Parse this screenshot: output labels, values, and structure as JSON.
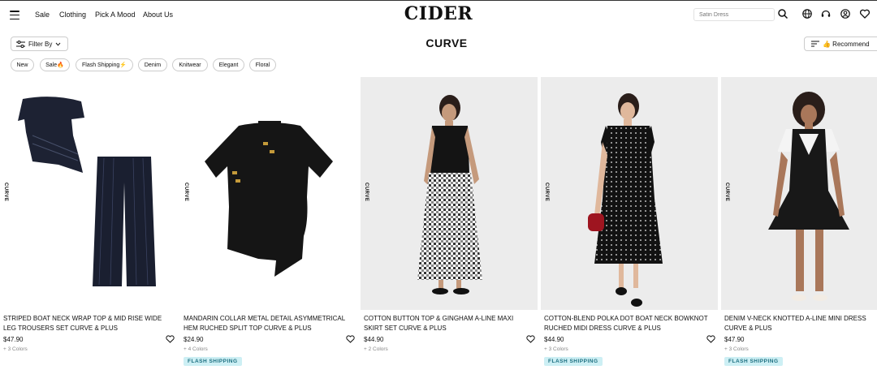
{
  "header": {
    "logo": "CIDER",
    "nav": [
      "Sale",
      "Clothing",
      "Pick A Mood",
      "About Us"
    ],
    "search_placeholder": "Satin Dress",
    "icons": [
      "menu-icon",
      "search-icon",
      "globe-icon",
      "support-icon",
      "account-icon",
      "wishlist-icon"
    ]
  },
  "toolbar": {
    "filter_label": "Filter By",
    "page_title": "CURVE",
    "sort_label": "👍 Recommend"
  },
  "chips": [
    "New",
    "Sale🔥",
    "Flash Shipping⚡",
    "Denim",
    "Knitwear",
    "Elegant",
    "Floral"
  ],
  "products": [
    {
      "side_label": "CURVE",
      "title": "STRIPED BOAT NECK WRAP TOP & MID RISE WIDE LEG TROUSERS SET CURVE & PLUS",
      "price": "$47.90",
      "colors": "+ 3 Colors",
      "badge": ""
    },
    {
      "side_label": "CURVE",
      "title": "MANDARIN COLLAR METAL DETAIL ASYMMETRICAL HEM RUCHED SPLIT TOP CURVE & PLUS",
      "price": "$24.90",
      "colors": "+ 4 Colors",
      "badge": "FLASH SHIPPING"
    },
    {
      "side_label": "CURVE",
      "title": "COTTON BUTTON TOP & GINGHAM A-LINE MAXI SKIRT SET CURVE & PLUS",
      "price": "$44.90",
      "colors": "+ 2 Colors",
      "badge": ""
    },
    {
      "side_label": "CURVE",
      "title": "COTTON-BLEND POLKA DOT BOAT NECK BOWKNOT RUCHED MIDI DRESS CURVE & PLUS",
      "price": "$44.90",
      "colors": "+ 3 Colors",
      "badge": "FLASH SHIPPING"
    },
    {
      "side_label": "CURVE",
      "title": "DENIM V-NECK KNOTTED A-LINE MINI DRESS CURVE & PLUS",
      "price": "$47.90",
      "colors": "+ 3 Colors",
      "badge": "FLASH SHIPPING"
    }
  ],
  "colors": {
    "badge_bg": "#cdeff4",
    "badge_text": "#1c6f80",
    "photo_bg": "#ececec"
  }
}
